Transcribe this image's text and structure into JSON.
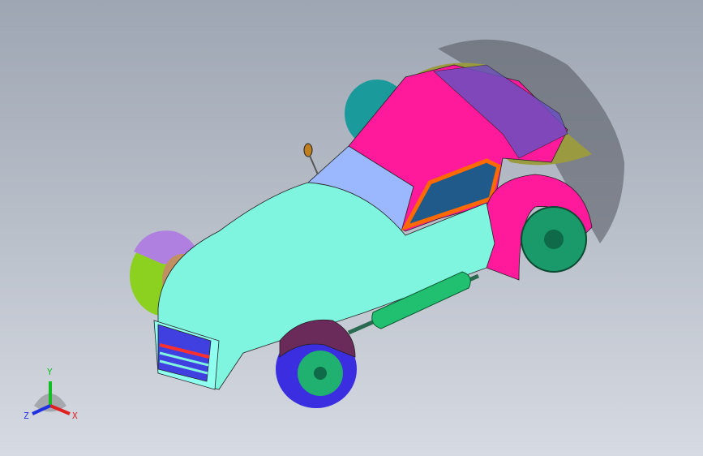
{
  "triad": {
    "x_label": "X",
    "y_label": "Y",
    "z_label": "Z",
    "colors": {
      "x": "#e02020",
      "y": "#10c020",
      "z": "#2030e0"
    }
  },
  "model": {
    "colors": {
      "body": "#7ff5e0",
      "cabin": "#ff1a9c",
      "glass": "#9bb8ff",
      "wheel_front": "#3a2ee0",
      "wheel_rear": "#1a9a6a",
      "fender": "#a070d0",
      "exhaust": "#20c070"
    }
  }
}
